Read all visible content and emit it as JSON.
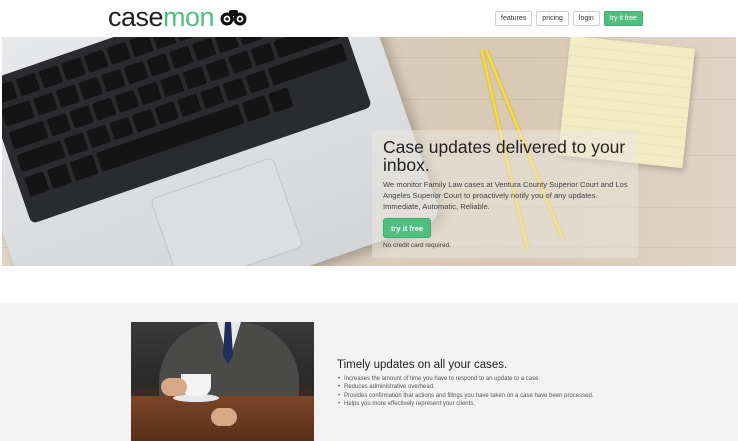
{
  "header": {
    "logo": {
      "part1": "case",
      "part2": "mon",
      "icon": "binoculars-icon"
    },
    "nav": [
      {
        "id": "features",
        "label": "features"
      },
      {
        "id": "pricing",
        "label": "pricing"
      },
      {
        "id": "login",
        "label": "login"
      },
      {
        "id": "try",
        "label": "try it free"
      }
    ]
  },
  "hero": {
    "title": "Case updates delivered to your inbox.",
    "description": "We monitor Family Law cases at Ventura County Superior Court and Los Angeles Superior Court to proactively notify you of any updates. Immediate, Automatic, Reliable.",
    "cta_label": "try it free",
    "note": "No credit card required."
  },
  "features": {
    "title": "Timely updates on all your cases.",
    "items": [
      "Increases the amount of time you have to respond to an update to a case.",
      "Reduces administrative overhead.",
      "Provides confirmation that actions and filings you have taken on a case have been processed.",
      "Helps you more effectively represent your clients."
    ]
  },
  "colors": {
    "accent": "#4fbf7f",
    "text": "#333333",
    "section_bg": "#f3f3f3"
  }
}
